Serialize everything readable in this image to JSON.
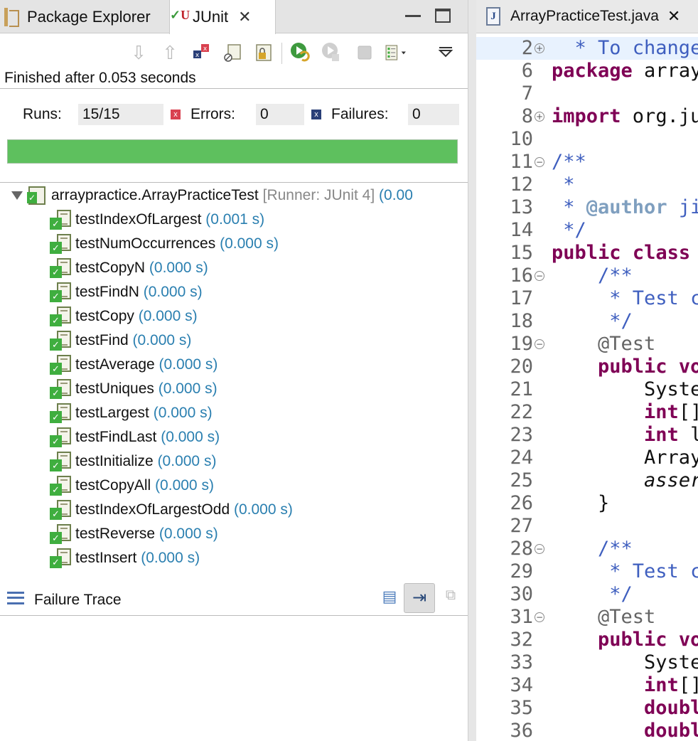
{
  "tabs": {
    "package_explorer": "Package Explorer",
    "junit": "JUnit"
  },
  "toolbar": {
    "icons": [
      "next-failure-icon",
      "previous-failure-icon",
      "show-failures-only-icon",
      "scroll-lock-icon",
      "lock-icon",
      "rerun-icon",
      "rerun-failed-icon",
      "stop-icon",
      "history-icon",
      "view-menu-icon"
    ]
  },
  "status": "Finished after 0.053 seconds",
  "counters": {
    "runs_label": "Runs:",
    "runs_value": "15/15",
    "errors_label": "Errors:",
    "errors_value": "0",
    "failures_label": "Failures:",
    "failures_value": "0"
  },
  "progress": {
    "fraction": 1.0,
    "color": "#5ec05e"
  },
  "tree": {
    "root": {
      "name": "arraypractice.ArrayPracticeTest",
      "runner": "[Runner: JUnit 4]",
      "time": "(0.00"
    },
    "tests": [
      {
        "name": "testIndexOfLargest",
        "time": "(0.001 s)"
      },
      {
        "name": "testNumOccurrences",
        "time": "(0.000 s)"
      },
      {
        "name": "testCopyN",
        "time": "(0.000 s)"
      },
      {
        "name": "testFindN",
        "time": "(0.000 s)"
      },
      {
        "name": "testCopy",
        "time": "(0.000 s)"
      },
      {
        "name": "testFind",
        "time": "(0.000 s)"
      },
      {
        "name": "testAverage",
        "time": "(0.000 s)"
      },
      {
        "name": "testUniques",
        "time": "(0.000 s)"
      },
      {
        "name": "testLargest",
        "time": "(0.000 s)"
      },
      {
        "name": "testFindLast",
        "time": "(0.000 s)"
      },
      {
        "name": "testInitialize",
        "time": "(0.000 s)"
      },
      {
        "name": "testCopyAll",
        "time": "(0.000 s)"
      },
      {
        "name": "testIndexOfLargestOdd",
        "time": "(0.000 s)"
      },
      {
        "name": "testReverse",
        "time": "(0.000 s)"
      },
      {
        "name": "testInsert",
        "time": "(0.000 s)"
      }
    ]
  },
  "failure_trace": {
    "label": "Failure Trace"
  },
  "editor": {
    "tab_title": "ArrayPracticeTest.java",
    "lines": [
      {
        "n": "2",
        "fold": "+",
        "hl": true,
        "seg": [
          [
            "cm",
            "  * To change"
          ]
        ]
      },
      {
        "n": "6",
        "seg": [
          [
            "kw",
            "package"
          ],
          [
            "",
            " array"
          ]
        ]
      },
      {
        "n": "7",
        "seg": []
      },
      {
        "n": "8",
        "fold": "+",
        "seg": [
          [
            "kw",
            "import"
          ],
          [
            "",
            " org.ju"
          ]
        ]
      },
      {
        "n": "10",
        "seg": []
      },
      {
        "n": "11",
        "fold": "-",
        "seg": [
          [
            "cm",
            "/**"
          ]
        ]
      },
      {
        "n": "12",
        "seg": [
          [
            "cm",
            " *"
          ]
        ]
      },
      {
        "n": "13",
        "seg": [
          [
            "cm",
            " * "
          ],
          [
            "tag",
            "@author"
          ],
          [
            "cm",
            " ji"
          ]
        ]
      },
      {
        "n": "14",
        "seg": [
          [
            "cm",
            " */"
          ]
        ]
      },
      {
        "n": "15",
        "seg": [
          [
            "kw",
            "public"
          ],
          [
            "",
            " "
          ],
          [
            "kw",
            "class"
          ]
        ]
      },
      {
        "n": "16",
        "fold": "-",
        "seg": [
          [
            "cm",
            "    /**"
          ]
        ]
      },
      {
        "n": "17",
        "seg": [
          [
            "cm",
            "     * Test c"
          ]
        ]
      },
      {
        "n": "18",
        "seg": [
          [
            "cm",
            "     */"
          ]
        ]
      },
      {
        "n": "19",
        "fold": "-",
        "seg": [
          [
            "an",
            "    @Test"
          ]
        ]
      },
      {
        "n": "20",
        "seg": [
          [
            "",
            "    "
          ],
          [
            "kw",
            "public"
          ],
          [
            "",
            " "
          ],
          [
            "kw",
            "vo"
          ]
        ]
      },
      {
        "n": "21",
        "seg": [
          [
            "",
            "        Syste"
          ]
        ]
      },
      {
        "n": "22",
        "seg": [
          [
            "",
            "        "
          ],
          [
            "kw",
            "int"
          ],
          [
            "",
            "[]"
          ]
        ]
      },
      {
        "n": "23",
        "seg": [
          [
            "",
            "        "
          ],
          [
            "kw",
            "int"
          ],
          [
            "",
            " l"
          ]
        ]
      },
      {
        "n": "24",
        "seg": [
          [
            "",
            "        Array"
          ]
        ]
      },
      {
        "n": "25",
        "seg": [
          [
            "",
            "        "
          ],
          [
            "it",
            "asser"
          ]
        ]
      },
      {
        "n": "26",
        "seg": [
          [
            "",
            "    }"
          ]
        ]
      },
      {
        "n": "27",
        "seg": []
      },
      {
        "n": "28",
        "fold": "-",
        "seg": [
          [
            "cm",
            "    /**"
          ]
        ]
      },
      {
        "n": "29",
        "seg": [
          [
            "cm",
            "     * Test c"
          ]
        ]
      },
      {
        "n": "30",
        "seg": [
          [
            "cm",
            "     */"
          ]
        ]
      },
      {
        "n": "31",
        "fold": "-",
        "seg": [
          [
            "an",
            "    @Test"
          ]
        ]
      },
      {
        "n": "32",
        "seg": [
          [
            "",
            "    "
          ],
          [
            "kw",
            "public"
          ],
          [
            "",
            " "
          ],
          [
            "kw",
            "vo"
          ]
        ]
      },
      {
        "n": "33",
        "seg": [
          [
            "",
            "        Syste"
          ]
        ]
      },
      {
        "n": "34",
        "seg": [
          [
            "",
            "        "
          ],
          [
            "kw",
            "int"
          ],
          [
            "",
            "[]"
          ]
        ]
      },
      {
        "n": "35",
        "seg": [
          [
            "",
            "        "
          ],
          [
            "kw",
            "doubl"
          ]
        ]
      },
      {
        "n": "36",
        "seg": [
          [
            "",
            "        "
          ],
          [
            "kw",
            "doubl"
          ]
        ]
      }
    ]
  }
}
